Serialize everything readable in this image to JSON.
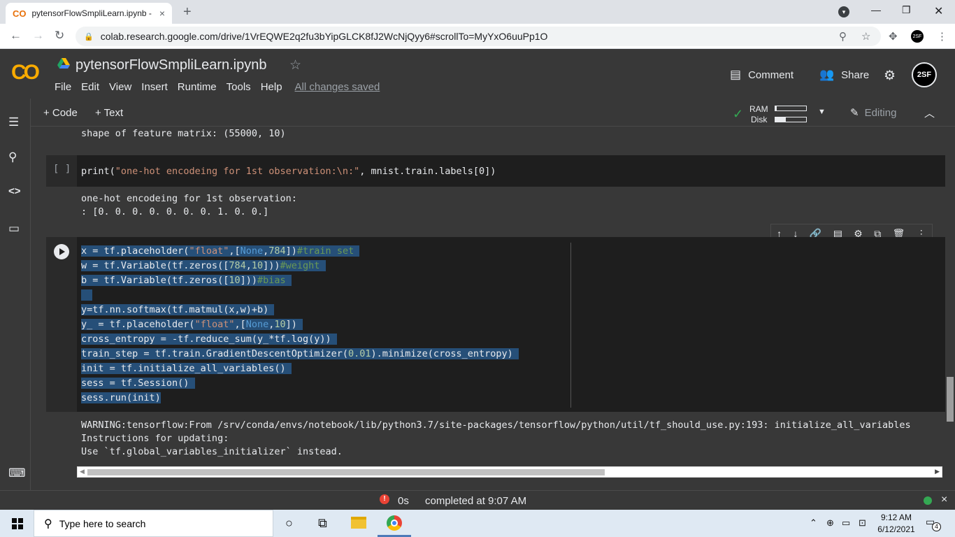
{
  "browser": {
    "tab_title": "pytensorFlowSmpliLearn.ipynb -",
    "tab_close": "×",
    "new_tab": "+",
    "url": "colab.research.google.com/drive/1VrEQWE2q2fu3bYipGLCK8fJ2WcNjQyy6#scrollTo=MyYxO6uuPp1O",
    "profile_initials": "2SF"
  },
  "colab": {
    "logo": "CO",
    "notebook_title": "pytensorFlowSmpliLearn.ipynb",
    "menu": [
      "File",
      "Edit",
      "View",
      "Insert",
      "Runtime",
      "Tools",
      "Help"
    ],
    "save_status": "All changes saved",
    "comment_label": "Comment",
    "share_label": "Share",
    "avatar_initials": "2SF",
    "add_code_label": "+ Code",
    "add_text_label": "+ Text",
    "ram_label": "RAM",
    "disk_label": "Disk",
    "ram_usage": 0.05,
    "disk_usage": 0.35,
    "editing_label": "Editing"
  },
  "cells": {
    "output_prev": "shape of feature matrix: (55000, 10)",
    "cell1_bracket": "[ ]",
    "cell1_code_pre": "print(",
    "cell1_code_str": "\"one-hot encodeing for 1st observation:\\n:\"",
    "cell1_code_post": ", mnist.train.labels[0])",
    "cell1_output": "one-hot encodeing for 1st observation:\n: [0. 0. 0. 0. 0. 0. 0. 1. 0. 0.]",
    "cell2_output": "WARNING:tensorflow:From /srv/conda/envs/notebook/lib/python3.7/site-packages/tensorflow/python/util/tf_should_use.py:193: initialize_all_variables\nInstructions for updating:\nUse `tf.global_variables_initializer` instead."
  },
  "status": {
    "error_icon": "!",
    "duration": "0s",
    "completed": "completed at 9:07 AM",
    "close": "×"
  },
  "taskbar": {
    "search_placeholder": "Type here to search",
    "time": "9:12 AM",
    "date": "6/12/2021",
    "notification_count": "4"
  },
  "icons": {
    "tab_favicon": "co-icon",
    "back": "arrow-left-icon",
    "forward": "arrow-right-icon",
    "reload": "reload-icon",
    "lock": "lock-icon",
    "zoom": "zoom-icon",
    "bookmark": "star-icon",
    "extensions": "puzzle-icon",
    "menu": "kebab-icon"
  }
}
